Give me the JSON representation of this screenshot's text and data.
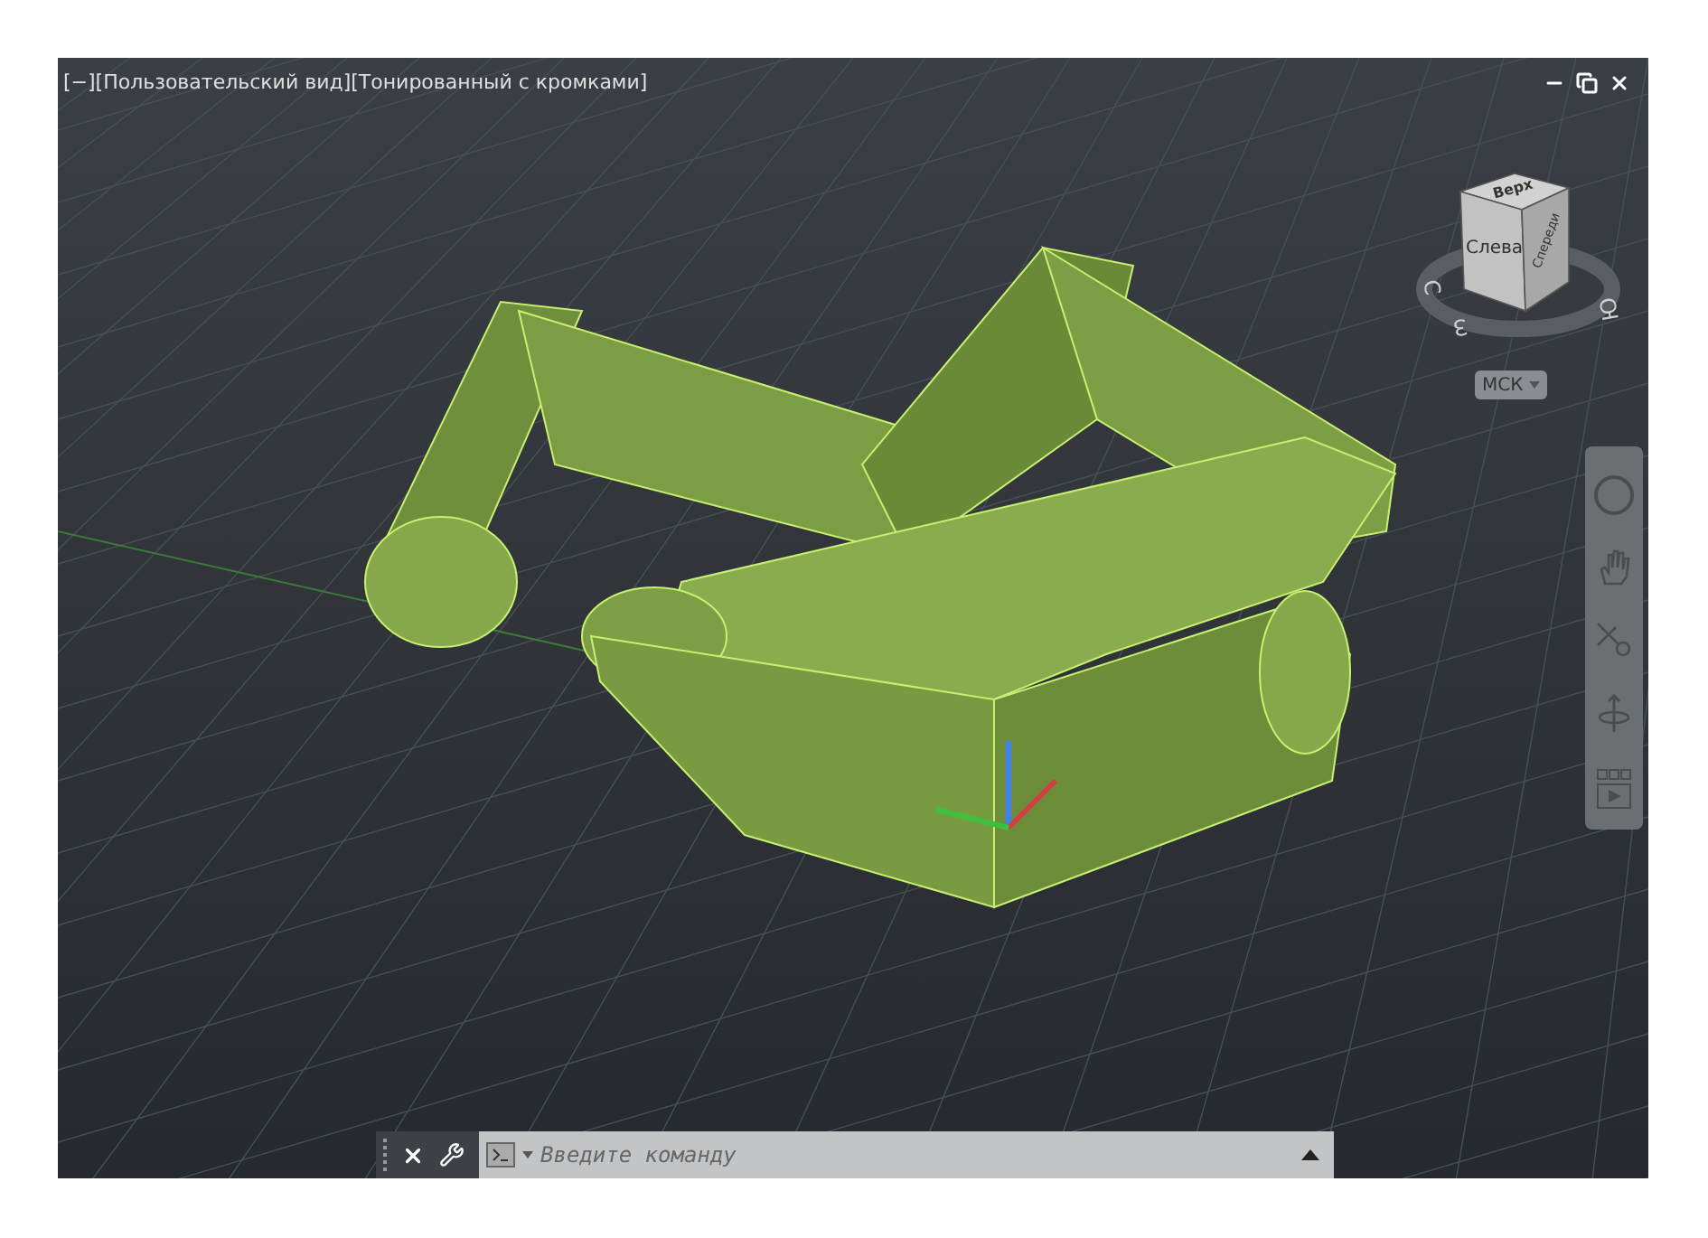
{
  "viewport": {
    "label": "[−][Пользовательский вид][Тонированный с кромками]"
  },
  "view_cube": {
    "faces": [
      {
        "kind": "top",
        "label": "Верх"
      },
      {
        "kind": "left",
        "label": "Слева"
      },
      {
        "kind": "front",
        "label": "Спереди"
      }
    ],
    "compass": [
      {
        "kind": "n",
        "label": "С"
      },
      {
        "kind": "w",
        "label": "З"
      },
      {
        "kind": "s",
        "label": "Ю"
      }
    ],
    "ucs_menu": {
      "label": "МСК"
    }
  },
  "command_line": {
    "placeholder": "Введите команду"
  }
}
